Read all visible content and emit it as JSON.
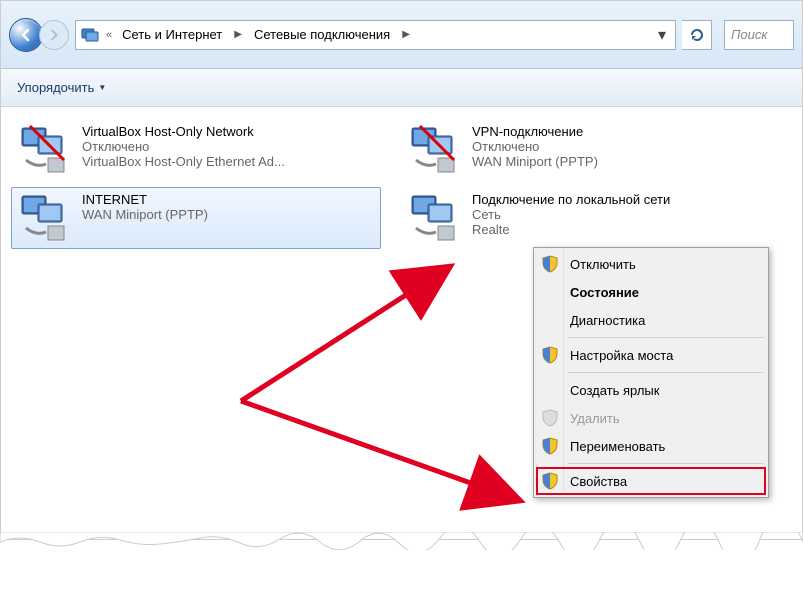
{
  "breadcrumb": {
    "level1": "Сеть и Интернет",
    "level2": "Сетевые подключения"
  },
  "search": {
    "placeholder": "Поиск"
  },
  "toolbar": {
    "organize": "Упорядочить"
  },
  "connections": [
    {
      "name": "VirtualBox Host-Only Network",
      "status": "Отключено",
      "device": "VirtualBox Host-Only Ethernet Ad...",
      "selected": false
    },
    {
      "name": "VPN-подключение",
      "status": "Отключено",
      "device": "WAN Miniport (PPTP)",
      "selected": false
    },
    {
      "name": "INTERNET",
      "status": "",
      "device": "WAN Miniport (PPTP)",
      "selected": true
    },
    {
      "name": "Подключение по локальной сети",
      "status": "Сеть",
      "device": "Realte",
      "selected": false
    }
  ],
  "context_menu": {
    "items": [
      {
        "label": "Отключить",
        "shield": true
      },
      {
        "label": "Состояние",
        "bold": true
      },
      {
        "label": "Диагностика"
      },
      {
        "sep": true
      },
      {
        "label": "Настройка моста",
        "shield": true
      },
      {
        "sep": true
      },
      {
        "label": "Создать ярлык"
      },
      {
        "label": "Удалить",
        "shield": true,
        "disabled": true
      },
      {
        "label": "Переименовать",
        "shield": true
      },
      {
        "sep": true
      },
      {
        "label": "Свойства",
        "shield": true,
        "highlighted": true
      }
    ]
  }
}
